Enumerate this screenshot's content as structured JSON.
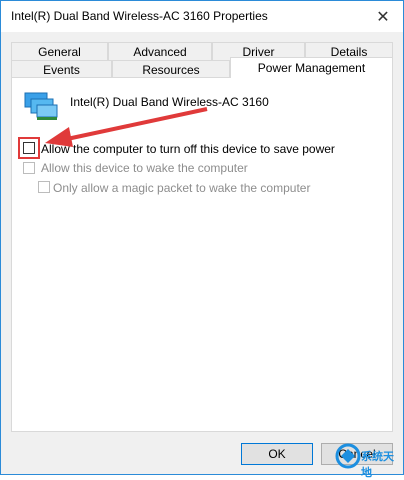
{
  "window": {
    "title": "Intel(R) Dual Band Wireless-AC 3160 Properties",
    "close_glyph": "✕"
  },
  "tabs_row1": [
    "General",
    "Advanced",
    "Driver",
    "Details"
  ],
  "tabs_row2": [
    "Events",
    "Resources",
    "Power Management"
  ],
  "active_tab": "Power Management",
  "device": {
    "name": "Intel(R) Dual Band Wireless-AC 3160",
    "icon": "network-adapter-icon"
  },
  "options": [
    {
      "label": "Allow the computer to turn off this device to save power",
      "checked": false,
      "enabled": true
    },
    {
      "label": "Allow this device to wake the computer",
      "checked": false,
      "enabled": false
    },
    {
      "label": "Only allow a magic packet to wake the computer",
      "checked": false,
      "enabled": false
    }
  ],
  "buttons": {
    "ok": "OK",
    "cancel": "Cancel"
  },
  "annotation": {
    "color": "#e03a3a"
  },
  "watermark": {
    "text": "系统天地"
  }
}
